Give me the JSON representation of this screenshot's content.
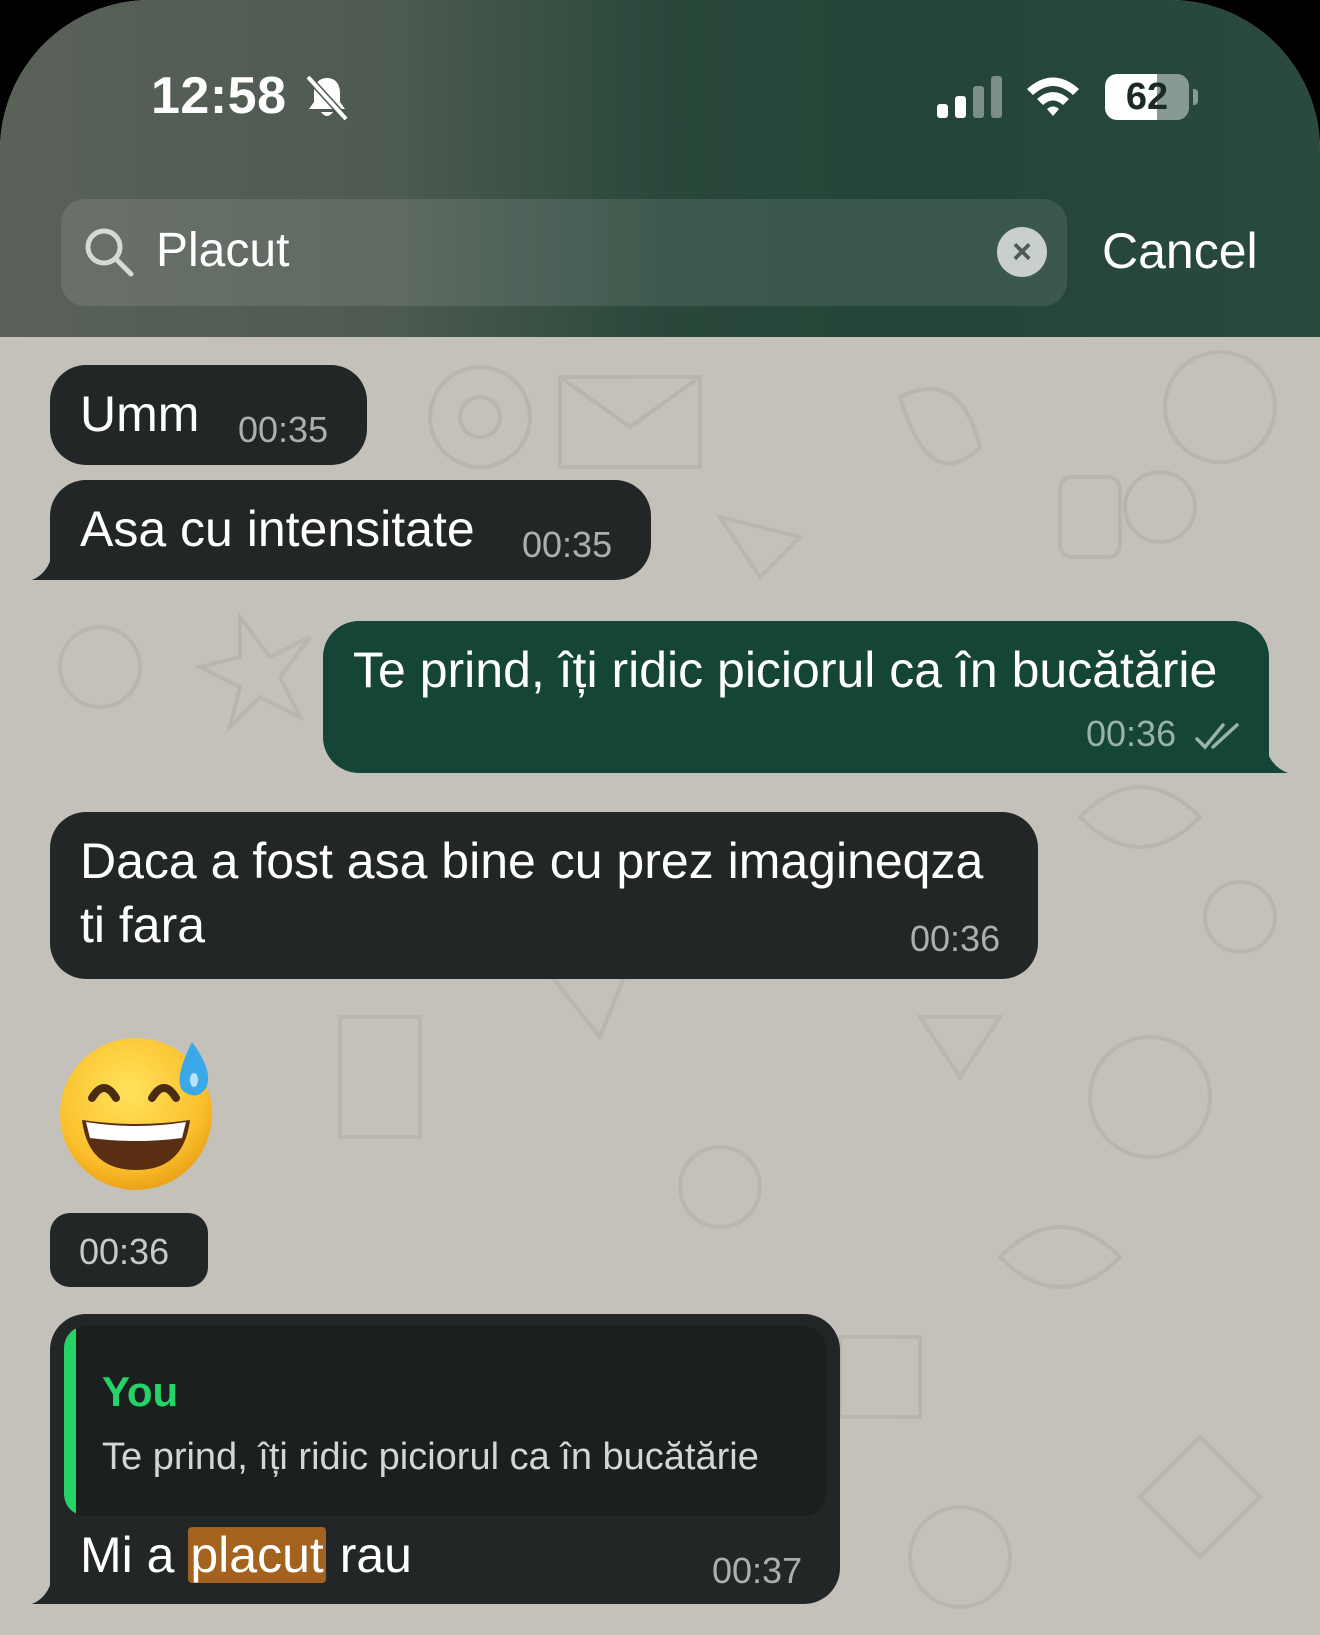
{
  "status_bar": {
    "time": "12:58",
    "battery": "62",
    "battery_level": 0.62,
    "icons": [
      "bell-slash-icon",
      "signal-icon",
      "wifi-icon",
      "battery-icon"
    ]
  },
  "search": {
    "value": "Placut",
    "clear_icon": "×",
    "cancel_label": "Cancel"
  },
  "colors": {
    "incoming_bubble": "#232626",
    "outgoing_bubble": "#154536",
    "highlight": "#a3621e",
    "quote_accent": "#25d366",
    "chat_background": "#c3c1b9"
  },
  "messages": [
    {
      "direction": "in",
      "text": "Umm",
      "time": "00:35"
    },
    {
      "direction": "in",
      "text": "Asa cu intensitate",
      "time": "00:35"
    },
    {
      "direction": "out",
      "text": "Te prind, îți ridic piciorul ca în bucătărie",
      "time": "00:36",
      "status": "read"
    },
    {
      "direction": "in",
      "text_line1": "Daca a fost asa bine cu prez imagineqza",
      "text_line2": "ti fara",
      "time": "00:36"
    },
    {
      "direction": "in",
      "emoji": "grinning-face-with-sweat",
      "time": "00:36"
    },
    {
      "direction": "in",
      "quote": {
        "author": "You",
        "text": "Te prind, îți ridic piciorul ca în bucătărie"
      },
      "text_before": "Mi a ",
      "text_match": "placut",
      "text_after": " rau",
      "time": "00:37"
    }
  ]
}
